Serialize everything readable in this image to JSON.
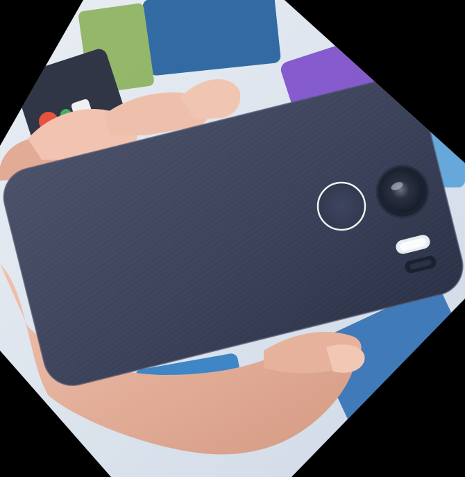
{
  "scene": {
    "subject": "smartphone-back-held-in-hand",
    "icons": {
      "camera": "camera-lens-icon",
      "fingerprint": "fingerprint-sensor-icon",
      "flash": "flash-icon"
    },
    "colors": {
      "phone_body": "#3a4157",
      "phone_highlight": "#5a6279",
      "skin": "#e7b6a3",
      "skin_shadow": "#c58c78",
      "background_blue": "#2f6fb3",
      "background_purple": "#7b4bc9",
      "background_green": "#4f9a3a",
      "corner_fill": "#000000"
    }
  }
}
